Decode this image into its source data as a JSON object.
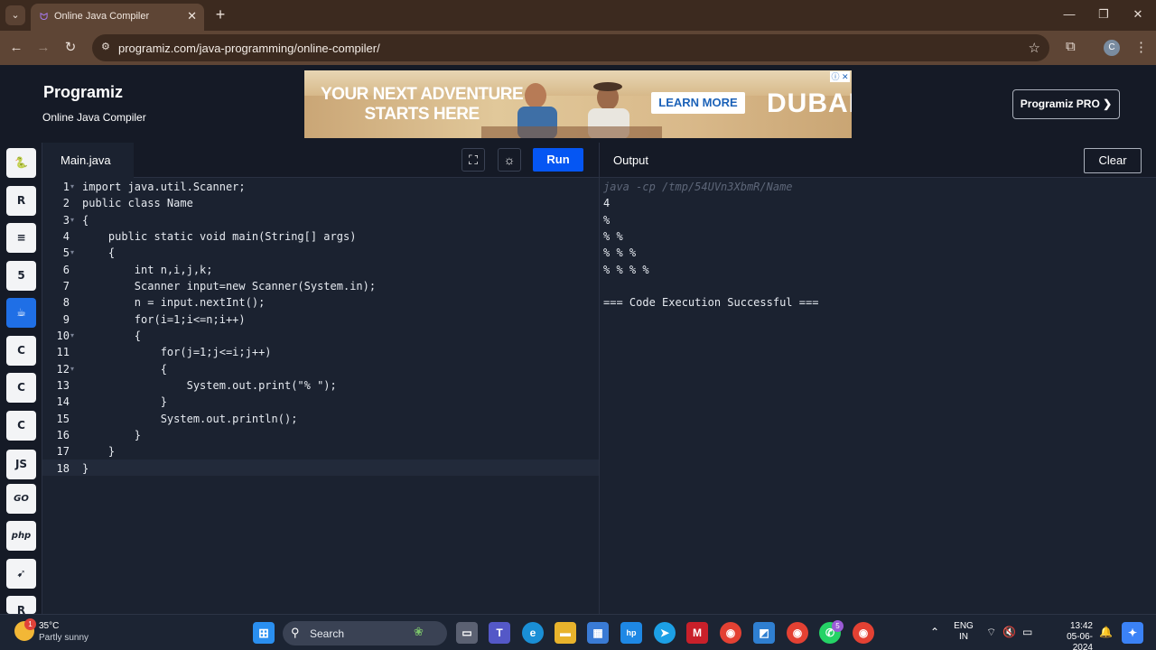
{
  "browser": {
    "tab_title": "Online Java Compiler",
    "url": "programiz.com/java-programming/online-compiler/"
  },
  "header": {
    "logo": "Programiz",
    "subtitle": "Online Java Compiler",
    "pro_button": "Programiz PRO ❯",
    "ad": {
      "headline_line1": "YOUR NEXT ADVENTURE",
      "headline_line2": "STARTS HERE",
      "cta": "LEARN MORE",
      "brand": "DUBAI"
    }
  },
  "sidebar": {
    "languages": [
      {
        "name": "python",
        "glyph": "🐍"
      },
      {
        "name": "r",
        "glyph": "R"
      },
      {
        "name": "sql",
        "glyph": "≡"
      },
      {
        "name": "html",
        "glyph": "5"
      },
      {
        "name": "java",
        "glyph": "☕",
        "active": true
      },
      {
        "name": "c",
        "glyph": "C"
      },
      {
        "name": "cpp",
        "glyph": "C"
      },
      {
        "name": "csharp",
        "glyph": "C"
      },
      {
        "name": "javascript",
        "glyph": "JS"
      },
      {
        "name": "go",
        "glyph": "GO"
      },
      {
        "name": "php",
        "glyph": "php"
      },
      {
        "name": "swift",
        "glyph": "➹"
      },
      {
        "name": "rust",
        "glyph": "R"
      }
    ]
  },
  "editor": {
    "file_tab": "Main.java",
    "run_label": "Run",
    "lines": [
      "import java.util.Scanner;",
      "public class Name",
      "{",
      "    public static void main(String[] args)",
      "    {",
      "        int n,i,j,k;",
      "        Scanner input=new Scanner(System.in);",
      "        n = input.nextInt();",
      "        for(i=1;i<=n;i++)",
      "        {",
      "            for(j=1;j<=i;j++)",
      "            {",
      "                System.out.print(\"% \");",
      "            }",
      "            System.out.println();",
      "        }",
      "    }",
      "}"
    ],
    "line_numbers": [
      "1",
      "2",
      "3",
      "4",
      "5",
      "6",
      "7",
      "8",
      "9",
      "10",
      "11",
      "12",
      "13",
      "14",
      "15",
      "16",
      "17",
      "18"
    ]
  },
  "output": {
    "title": "Output",
    "clear_label": "Clear",
    "command": "java -cp /tmp/54UVn3XbmR/Name",
    "lines": [
      "4",
      "%",
      "% %",
      "% % %",
      "% % % %",
      "",
      "=== Code Execution Successful ==="
    ]
  },
  "taskbar": {
    "temperature": "35°C",
    "condition": "Partly sunny",
    "weather_badge": "1",
    "search_placeholder": "Search",
    "language_line1": "ENG",
    "language_line2": "IN",
    "time": "13:42",
    "date": "05-06-2024",
    "whatsapp_badge": "5"
  }
}
